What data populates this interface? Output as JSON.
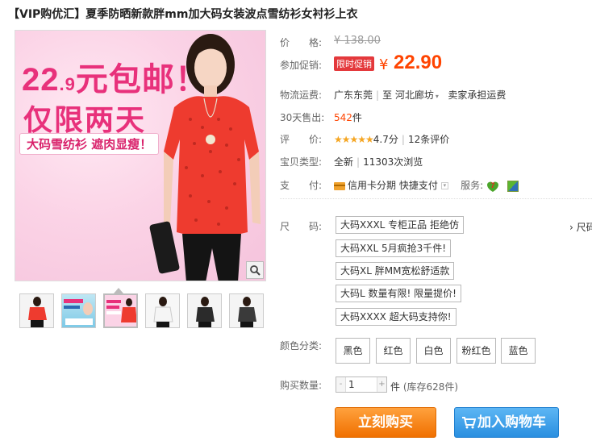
{
  "title": "【VIP购优汇】夏季防晒新款胖mm加大码女装波点雪纺衫女衬衫上衣",
  "image": {
    "promo_line1_big": "22",
    "promo_line1_small": ".9",
    "promo_line1_rest": "元包邮！",
    "promo_line2": "仅限两天",
    "promo_line3": "大码雪纺衫 遮肉显瘦！",
    "zoom_icon": "magnifier-icon"
  },
  "price": {
    "label": "价　　格:",
    "original": "¥ 138.00",
    "promo_label": "参加促销:",
    "promo_tag": "限时促销",
    "currency": "¥",
    "current": "22.90"
  },
  "shipping": {
    "label": "物流运费:",
    "from": "广东东莞",
    "to_prefix": "至",
    "to": "河北廊坊",
    "note": "卖家承担运费"
  },
  "sales": {
    "label": "30天售出:",
    "count": "542",
    "unit": "件"
  },
  "rating": {
    "label": "评　　价:",
    "stars": "★★★★★",
    "score": "4.7分",
    "reviews": "12条评价"
  },
  "type": {
    "label": "宝贝类型:",
    "condition": "全新",
    "views": "11303次浏览"
  },
  "payment": {
    "label": "支　　付:",
    "credit": "信用卡分期",
    "quick": "快捷支付",
    "service_label": "服务:"
  },
  "size": {
    "label": "尺　　码:",
    "guide": "› 尺码",
    "options": [
      "大码XXXL 专柜正品 拒绝仿",
      "大码XXL 5月疯抢3千件!",
      "大码XL 胖MM宽松舒适款",
      "大码L 数量有限! 限量提价!",
      "大码XXXX 超大码支持你!"
    ]
  },
  "color": {
    "label": "颜色分类:",
    "options": [
      "黑色",
      "红色",
      "白色",
      "粉红色",
      "蓝色"
    ]
  },
  "quantity": {
    "label": "购买数量:",
    "value": "1",
    "unit": "件",
    "stock": "(库存628件)"
  },
  "buttons": {
    "buy": "立刻购买",
    "cart": "加入购物车"
  },
  "colors": {
    "accent": "#ff4400",
    "promo_pink": "#e8317b",
    "buy_orange": "#f07000",
    "cart_blue": "#2a8fe0"
  }
}
